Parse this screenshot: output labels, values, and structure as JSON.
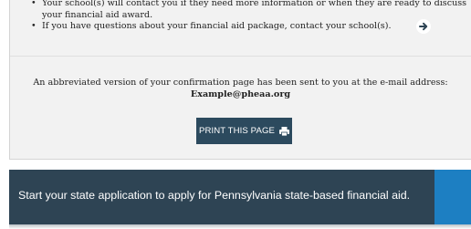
{
  "instructions": {
    "items": [
      "Your school(s) will contact you if they need more information or when they are ready to discuss your financial aid award.",
      "If you have questions about your financial aid package, contact your school(s)."
    ]
  },
  "confirmation": {
    "message": "An abbreviated version of your confirmation page has been sent to you at the e-mail address:",
    "email": "Example@pheaa.org"
  },
  "print_button": {
    "label": "PRINT THIS PAGE",
    "icon": "printer-icon"
  },
  "state_banner": {
    "text": "Start your state application to apply for Pennsylvania state-based financial aid.",
    "icon": "arrow-right-circle-icon"
  },
  "colors": {
    "panel_bg": "#f2f2f2",
    "button_bg": "#2c4a5e",
    "banner_bg": "#2e4454",
    "banner_accent": "#1d7fc2"
  }
}
